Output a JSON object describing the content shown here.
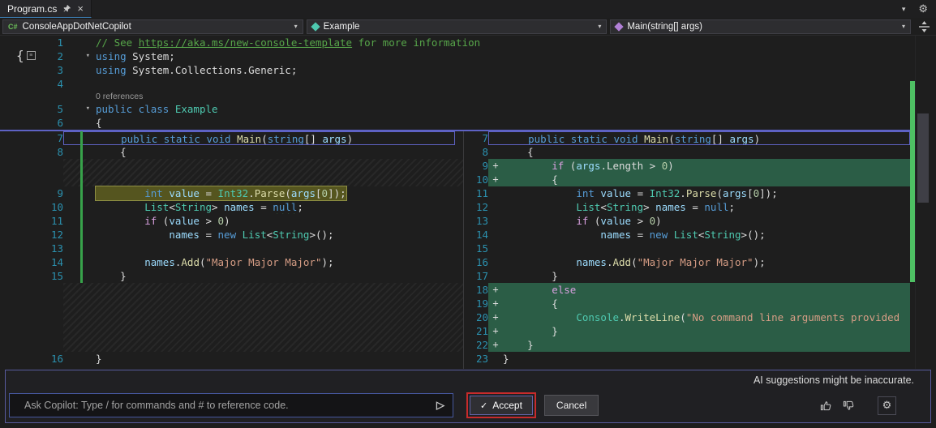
{
  "tab": {
    "title": "Program.cs"
  },
  "navbar": {
    "project": "ConsoleAppDotNetCopilot",
    "type": "Example",
    "member": "Main(string[] args)"
  },
  "icons": {
    "close": "×",
    "chevron_down": "▾",
    "gear": "⚙",
    "dropdown": "▾",
    "fold": "▾",
    "plus": "+",
    "send": "▷",
    "check": "✓",
    "project": "C#"
  },
  "editor": {
    "top": [
      {
        "n": "1",
        "seg": [
          [
            "// See ",
            "cm"
          ],
          [
            "https://aka.ms/new-console-template",
            "cm lnk"
          ],
          [
            " for more information",
            "cm"
          ]
        ]
      },
      {
        "n": "2",
        "fold": true,
        "seg": [
          [
            "using ",
            "kw"
          ],
          [
            "System;",
            "pln"
          ]
        ]
      },
      {
        "n": "3",
        "seg": [
          [
            "using ",
            "kw"
          ],
          [
            "System.Collections.Generic;",
            "pln"
          ]
        ]
      },
      {
        "n": "4",
        "seg": []
      },
      {
        "lens": "0 references"
      },
      {
        "n": "5",
        "fold": true,
        "seg": [
          [
            "public class ",
            "kw"
          ],
          [
            "Example",
            "typ"
          ]
        ]
      },
      {
        "n": "6",
        "seg": [
          [
            "{",
            "pln"
          ]
        ]
      }
    ],
    "original": [
      {
        "n": "7",
        "box": true,
        "seg": [
          [
            "    ",
            "pln"
          ],
          [
            "public static void ",
            "kw"
          ],
          [
            "Main",
            "mth"
          ],
          [
            "(",
            "pln"
          ],
          [
            "string",
            "kw"
          ],
          [
            "[] ",
            "pln"
          ],
          [
            "args",
            "prm"
          ],
          [
            ")",
            "pln"
          ]
        ]
      },
      {
        "n": "8",
        "seg": [
          [
            "    {",
            "pln"
          ]
        ]
      },
      {
        "sp": true
      },
      {
        "sp": true
      },
      {
        "n": "9",
        "hl": true,
        "seg": [
          [
            "        ",
            "pln"
          ],
          [
            "int ",
            "kw"
          ],
          [
            "value ",
            "loc"
          ],
          [
            "= ",
            "pln"
          ],
          [
            "Int32",
            "typ"
          ],
          [
            ".",
            "pln"
          ],
          [
            "Parse",
            "mth"
          ],
          [
            "(",
            "pln"
          ],
          [
            "args",
            "prm"
          ],
          [
            "[",
            "pln"
          ],
          [
            "0",
            "num"
          ],
          [
            "]);",
            "pln"
          ]
        ]
      },
      {
        "n": "10",
        "seg": [
          [
            "        ",
            "pln"
          ],
          [
            "List",
            "typ"
          ],
          [
            "<",
            "pln"
          ],
          [
            "String",
            "typ"
          ],
          [
            "> ",
            "pln"
          ],
          [
            "names ",
            "loc"
          ],
          [
            "= ",
            "pln"
          ],
          [
            "null",
            "kw sq"
          ],
          [
            ";",
            "pln"
          ]
        ]
      },
      {
        "n": "11",
        "seg": [
          [
            "        ",
            "pln"
          ],
          [
            "if ",
            "ctl"
          ],
          [
            "(",
            "pln"
          ],
          [
            "value ",
            "loc"
          ],
          [
            "> ",
            "pln"
          ],
          [
            "0",
            "num"
          ],
          [
            ")",
            "pln"
          ]
        ]
      },
      {
        "n": "12",
        "seg": [
          [
            "            ",
            "pln"
          ],
          [
            "names ",
            "loc"
          ],
          [
            "= ",
            "pln"
          ],
          [
            "new ",
            "kw"
          ],
          [
            "List",
            "typ"
          ],
          [
            "<",
            "pln"
          ],
          [
            "String",
            "typ"
          ],
          [
            ">();",
            "pln"
          ]
        ]
      },
      {
        "n": "13",
        "seg": []
      },
      {
        "n": "14",
        "seg": [
          [
            "        ",
            "pln"
          ],
          [
            "names",
            "loc sq"
          ],
          [
            ".",
            "pln"
          ],
          [
            "Add",
            "mth"
          ],
          [
            "(",
            "pln"
          ],
          [
            "\"Major Major Major\"",
            "str"
          ],
          [
            ");",
            "pln"
          ]
        ]
      },
      {
        "n": "15",
        "seg": [
          [
            "    }",
            "pln"
          ]
        ]
      },
      {
        "sp": true
      },
      {
        "sp": true
      },
      {
        "sp": true
      },
      {
        "sp": true
      },
      {
        "sp": true
      },
      {
        "n": "16",
        "seg": [
          [
            "}",
            "pln"
          ]
        ]
      }
    ],
    "modified": [
      {
        "n": "7",
        "box": true,
        "seg": [
          [
            "    ",
            "pln"
          ],
          [
            "public static void ",
            "kw"
          ],
          [
            "Main",
            "mth"
          ],
          [
            "(",
            "pln"
          ],
          [
            "string",
            "kw"
          ],
          [
            "[] ",
            "pln"
          ],
          [
            "args",
            "prm"
          ],
          [
            ")",
            "pln"
          ]
        ]
      },
      {
        "n": "8",
        "seg": [
          [
            "    {",
            "pln"
          ]
        ]
      },
      {
        "n": "9",
        "add": true,
        "seg": [
          [
            "        ",
            "pln"
          ],
          [
            "if ",
            "ctl"
          ],
          [
            "(",
            "pln"
          ],
          [
            "args",
            "prm"
          ],
          [
            ".",
            "pln"
          ],
          [
            "Length ",
            "pln"
          ],
          [
            "> ",
            "pln"
          ],
          [
            "0",
            "num"
          ],
          [
            ")",
            "pln"
          ]
        ]
      },
      {
        "n": "10",
        "add": true,
        "seg": [
          [
            "        {",
            "pln"
          ]
        ]
      },
      {
        "n": "11",
        "seg": [
          [
            "            ",
            "pln"
          ],
          [
            "int ",
            "kw"
          ],
          [
            "value ",
            "loc"
          ],
          [
            "= ",
            "pln"
          ],
          [
            "Int32",
            "typ"
          ],
          [
            ".",
            "pln"
          ],
          [
            "Parse",
            "mth"
          ],
          [
            "(",
            "pln"
          ],
          [
            "args",
            "prm"
          ],
          [
            "[",
            "pln"
          ],
          [
            "0",
            "num"
          ],
          [
            "]);",
            "pln"
          ]
        ]
      },
      {
        "n": "12",
        "seg": [
          [
            "            ",
            "pln"
          ],
          [
            "List",
            "typ"
          ],
          [
            "<",
            "pln"
          ],
          [
            "String",
            "typ"
          ],
          [
            "> ",
            "pln"
          ],
          [
            "names ",
            "loc"
          ],
          [
            "= ",
            "pln"
          ],
          [
            "null",
            "kw"
          ],
          [
            ";",
            "pln"
          ]
        ]
      },
      {
        "n": "13",
        "seg": [
          [
            "            ",
            "pln"
          ],
          [
            "if ",
            "ctl"
          ],
          [
            "(",
            "pln"
          ],
          [
            "value ",
            "loc"
          ],
          [
            "> ",
            "pln"
          ],
          [
            "0",
            "num"
          ],
          [
            ")",
            "pln"
          ]
        ]
      },
      {
        "n": "14",
        "seg": [
          [
            "                ",
            "pln"
          ],
          [
            "names ",
            "loc"
          ],
          [
            "= ",
            "pln"
          ],
          [
            "new ",
            "kw"
          ],
          [
            "List",
            "typ"
          ],
          [
            "<",
            "pln"
          ],
          [
            "String",
            "typ"
          ],
          [
            ">();",
            "pln"
          ]
        ]
      },
      {
        "n": "15",
        "seg": []
      },
      {
        "n": "16",
        "seg": [
          [
            "            ",
            "pln"
          ],
          [
            "names",
            "loc"
          ],
          [
            ".",
            "pln"
          ],
          [
            "Add",
            "mth"
          ],
          [
            "(",
            "pln"
          ],
          [
            "\"Major Major Major\"",
            "str"
          ],
          [
            ");",
            "pln"
          ]
        ]
      },
      {
        "n": "17",
        "seg": [
          [
            "        }",
            "pln"
          ]
        ]
      },
      {
        "n": "18",
        "add": true,
        "seg": [
          [
            "        ",
            "pln"
          ],
          [
            "else",
            "ctl"
          ]
        ]
      },
      {
        "n": "19",
        "add": true,
        "seg": [
          [
            "        {",
            "pln"
          ]
        ]
      },
      {
        "n": "20",
        "add": true,
        "seg": [
          [
            "            ",
            "pln"
          ],
          [
            "Console",
            "typ"
          ],
          [
            ".",
            "pln"
          ],
          [
            "WriteLine",
            "mth"
          ],
          [
            "(",
            "pln"
          ],
          [
            "\"No command line arguments provided",
            "str"
          ]
        ]
      },
      {
        "n": "21",
        "add": true,
        "seg": [
          [
            "        }",
            "pln"
          ]
        ]
      },
      {
        "n": "22",
        "add": true,
        "seg": [
          [
            "    }",
            "pln"
          ]
        ]
      },
      {
        "n": "23",
        "seg": [
          [
            "}",
            "pln"
          ]
        ]
      }
    ]
  },
  "copilot": {
    "disclaimer": "AI suggestions might be inaccurate.",
    "placeholder": "Ask Copilot: Type / for commands and # to reference code.",
    "accept": "Accept",
    "cancel": "Cancel"
  },
  "colors": {
    "accent": "#5E62C4",
    "added_line_bg": "#2B5D46",
    "highlight_line_bg": "#55551F",
    "attention_outline": "#C72B2B",
    "change_bar": "#37A24A"
  }
}
